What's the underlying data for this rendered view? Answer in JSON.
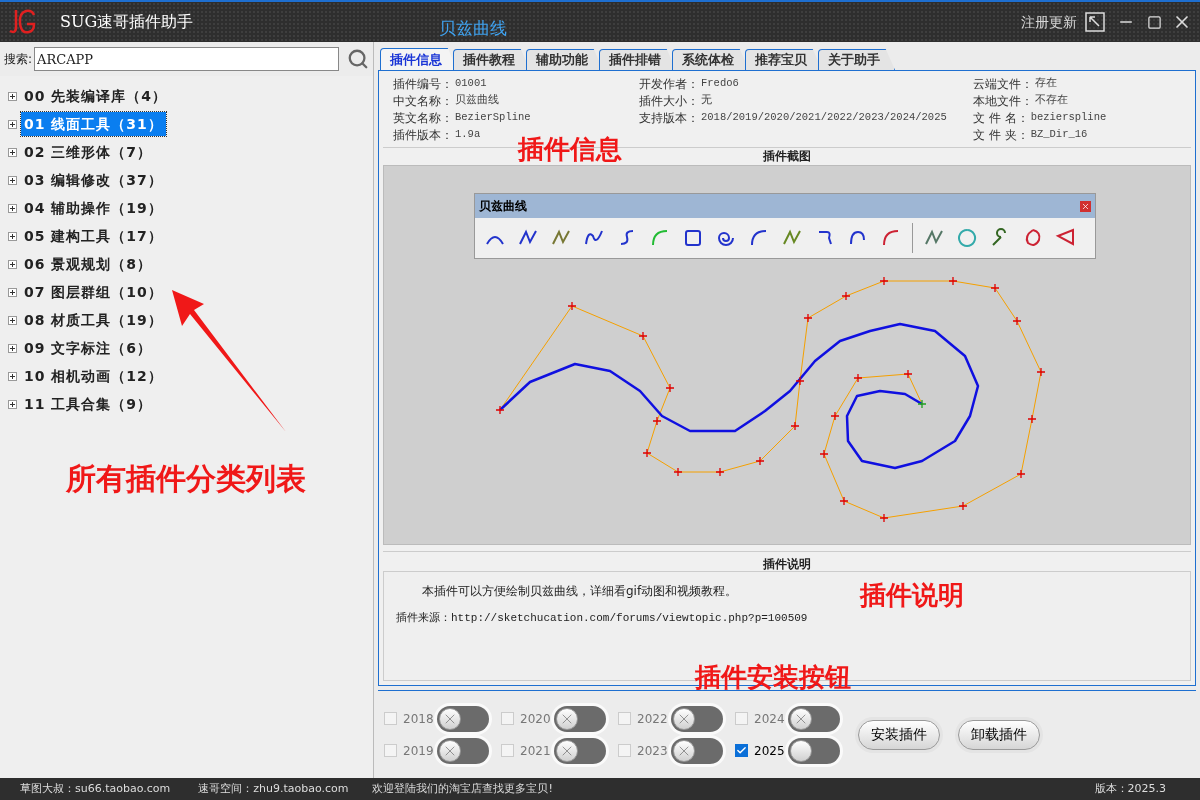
{
  "window": {
    "title": "SUG速哥插件助手",
    "plugin_title": "贝兹曲线",
    "register_link": "注册更新"
  },
  "search": {
    "label": "搜索:",
    "value": "ARCAPP"
  },
  "categories": [
    {
      "label": "00 先装编译库（4）",
      "selected": false,
      "expanded": false
    },
    {
      "label": "01 线面工具（31）",
      "selected": true,
      "expanded": false
    },
    {
      "label": "02 三维形体（7）",
      "selected": false,
      "expanded": false
    },
    {
      "label": "03 编辑修改（37）",
      "selected": false,
      "expanded": false
    },
    {
      "label": "04 辅助操作（19）",
      "selected": false,
      "expanded": false
    },
    {
      "label": "05 建构工具（17）",
      "selected": false,
      "expanded": false
    },
    {
      "label": "06 景观规划（8）",
      "selected": false,
      "expanded": false
    },
    {
      "label": "07 图层群组（10）",
      "selected": false,
      "expanded": false
    },
    {
      "label": "08 材质工具（19）",
      "selected": false,
      "expanded": false
    },
    {
      "label": "09 文字标注（6）",
      "selected": false,
      "expanded": false
    },
    {
      "label": "10 相机动画（12）",
      "selected": false,
      "expanded": false
    },
    {
      "label": "11 工具合集（9）",
      "selected": false,
      "expanded": false
    }
  ],
  "tabs": [
    {
      "label": "插件信息",
      "selected": true
    },
    {
      "label": "插件教程",
      "selected": false
    },
    {
      "label": "辅助功能",
      "selected": false
    },
    {
      "label": "插件排错",
      "selected": false
    },
    {
      "label": "系统体检",
      "selected": false
    },
    {
      "label": "推荐宝贝",
      "selected": false
    },
    {
      "label": "关于助手",
      "selected": false
    }
  ],
  "info": [
    [
      {
        "label": "插件编号：",
        "value": "01001"
      },
      {
        "label": "中文名称：",
        "value": "贝兹曲线"
      },
      {
        "label": "英文名称：",
        "value": "BezierSpline"
      },
      {
        "label": "插件版本：",
        "value": "1.9a"
      }
    ],
    [
      {
        "label": "开发作者：",
        "value": "Fredo6"
      },
      {
        "label": "插件大小：",
        "value": "无"
      },
      {
        "label": "支持版本：",
        "value": "2018/2019/2020/2021/2022/2023/2024/2025"
      }
    ],
    [
      {
        "label": "云端文件：",
        "value": "存在"
      },
      {
        "label": "本地文件：",
        "value": "不存在"
      },
      {
        "label": "文 件 名：",
        "value": "bezierspline"
      },
      {
        "label": "文 件 夹：",
        "value": "BZ_Dir_16"
      }
    ]
  ],
  "screenshot": {
    "title": "插件截图",
    "toolbar_title": "贝兹曲线"
  },
  "description": {
    "title": "插件说明",
    "text": "本插件可以方便绘制贝兹曲线，详细看gif动图和视频教程。",
    "source": "插件来源：http://sketchucation.com/forums/viewtopic.php?p=100509"
  },
  "versions": [
    {
      "year": "2018",
      "checked": false,
      "blocked": true
    },
    {
      "year": "2019",
      "checked": false,
      "blocked": true
    },
    {
      "year": "2020",
      "checked": false,
      "blocked": true
    },
    {
      "year": "2021",
      "checked": false,
      "blocked": true
    },
    {
      "year": "2022",
      "checked": false,
      "blocked": true
    },
    {
      "year": "2023",
      "checked": false,
      "blocked": true
    },
    {
      "year": "2024",
      "checked": false,
      "blocked": true
    },
    {
      "year": "2025",
      "checked": true,
      "blocked": false
    }
  ],
  "buttons": [
    "安装插件",
    "卸载插件"
  ],
  "status_bar": {
    "items": [
      "草图大叔：su66.taobao.com",
      "速哥空间：zhu9.taobao.com",
      "欢迎登陆我们的淘宝店查找更多宝贝!"
    ],
    "version": "版本：2025.3"
  },
  "annotations": [
    {
      "text": "插件信息"
    },
    {
      "text": "所有插件分类列表"
    },
    {
      "text": "插件说明"
    },
    {
      "text": "插件安装按钮"
    }
  ]
}
